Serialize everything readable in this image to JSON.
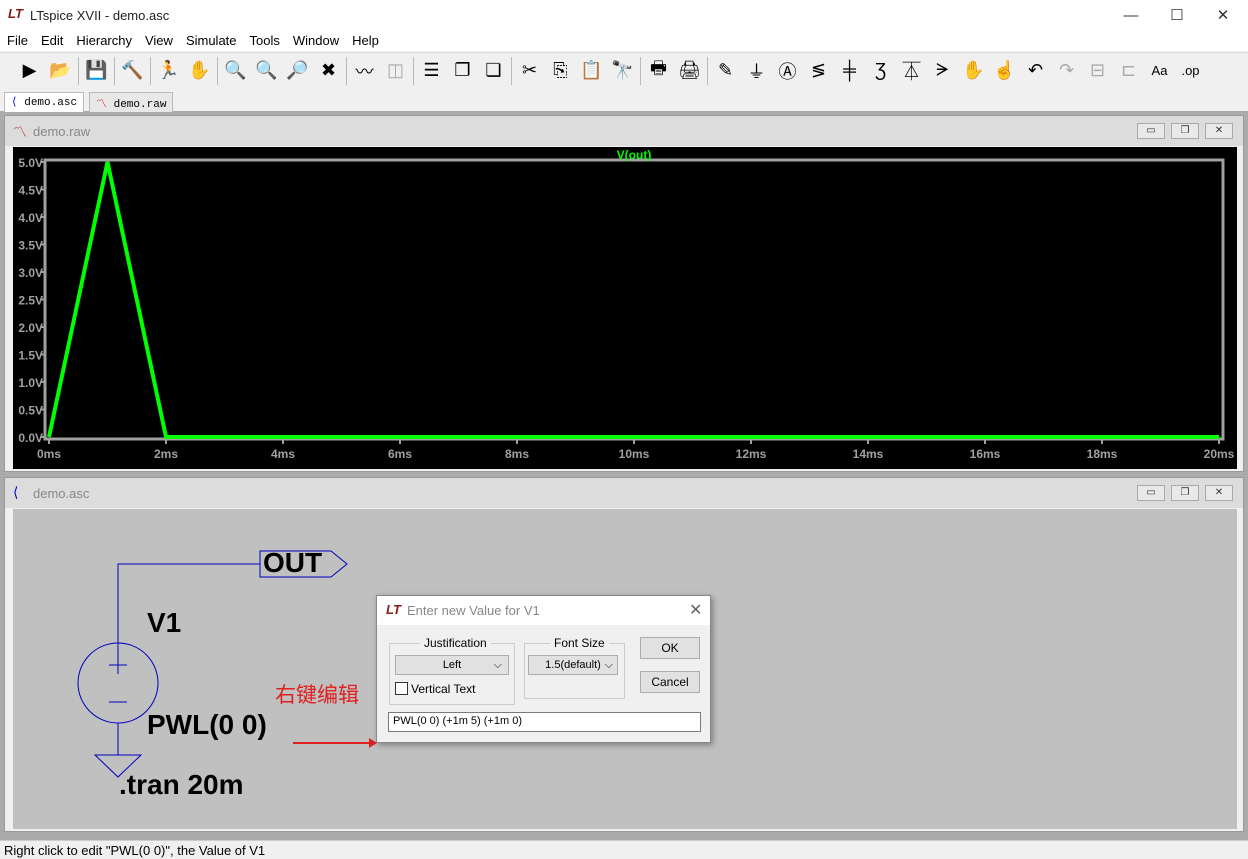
{
  "window": {
    "title": "LTspice XVII - demo.asc",
    "logo": "LT"
  },
  "menu": [
    "File",
    "Edit",
    "Hierarchy",
    "View",
    "Simulate",
    "Tools",
    "Window",
    "Help"
  ],
  "toolbar": [
    {
      "name": "run-icon",
      "glyph": "▶"
    },
    {
      "name": "open-icon",
      "glyph": "📂"
    },
    "sep",
    {
      "name": "save-icon",
      "glyph": "💾"
    },
    "sep",
    {
      "name": "control-panel-hammer-icon",
      "glyph": "🔨"
    },
    "sep",
    {
      "name": "halt-runner-icon",
      "glyph": "🏃"
    },
    {
      "name": "pan-hand-icon",
      "glyph": "✋",
      "dis": true
    },
    "sep",
    {
      "name": "zoom-in-icon",
      "glyph": "🔍"
    },
    {
      "name": "zoom-full-icon",
      "glyph": "🔍",
      "dis": true
    },
    {
      "name": "zoom-out-icon",
      "glyph": "🔎"
    },
    {
      "name": "zoom-cancel-icon",
      "glyph": "✖"
    },
    "sep",
    {
      "name": "autorange-waveform-icon",
      "glyph": "〰"
    },
    {
      "name": "fft-icon",
      "glyph": "◫",
      "dis": true
    },
    "sep",
    {
      "name": "tile-horizontal-icon",
      "glyph": "☰"
    },
    {
      "name": "cascade-icon",
      "glyph": "❐"
    },
    {
      "name": "close-all-icon",
      "glyph": "❏"
    },
    "sep",
    {
      "name": "cut-icon",
      "glyph": "✂"
    },
    {
      "name": "copy-icon",
      "glyph": "⎘"
    },
    {
      "name": "paste-icon",
      "glyph": "📋"
    },
    {
      "name": "find-icon",
      "glyph": "🔭"
    },
    "sep",
    {
      "name": "print-preview-icon",
      "glyph": "🖶"
    },
    {
      "name": "print-icon",
      "glyph": "🖨"
    },
    "sep",
    {
      "name": "draw-wire-icon",
      "glyph": "✎"
    },
    {
      "name": "ground-icon",
      "glyph": "⏚"
    },
    {
      "name": "label-net-icon",
      "glyph": "Ⓐ"
    },
    {
      "name": "resistor-icon",
      "glyph": "≶"
    },
    {
      "name": "capacitor-icon",
      "glyph": "╪"
    },
    {
      "name": "inductor-icon",
      "glyph": "Ʒ"
    },
    {
      "name": "diode-icon",
      "glyph": "⏄"
    },
    {
      "name": "component-icon",
      "glyph": "ᗒ"
    },
    {
      "name": "move-hand-icon",
      "glyph": "✋"
    },
    {
      "name": "drag-hand-icon",
      "glyph": "☝"
    },
    {
      "name": "undo-icon",
      "glyph": "↶"
    },
    {
      "name": "redo-icon",
      "glyph": "↷",
      "dis": true
    },
    {
      "name": "rotate-icon",
      "glyph": "⊟",
      "dis": true
    },
    {
      "name": "mirror-icon",
      "glyph": "⊏",
      "dis": true
    },
    {
      "name": "text-icon",
      "glyph": "Aa"
    },
    {
      "name": "spice-directive-icon",
      "glyph": ".op"
    }
  ],
  "tabs": [
    {
      "label": "demo.asc",
      "active": true
    },
    {
      "label": "demo.raw",
      "active": false
    }
  ],
  "waveform_window": {
    "title": "demo.raw"
  },
  "schematic_window": {
    "title": "demo.asc"
  },
  "chart_data": {
    "type": "line",
    "title": "",
    "series": [
      {
        "name": "V(out)",
        "color": "#00ff00",
        "x": [
          0,
          1,
          2,
          20
        ],
        "y": [
          0,
          5,
          0,
          0
        ]
      }
    ],
    "xlim": [
      0,
      20
    ],
    "ylim": [
      0,
      5
    ],
    "xticks": [
      "0ms",
      "2ms",
      "4ms",
      "6ms",
      "8ms",
      "10ms",
      "12ms",
      "14ms",
      "16ms",
      "18ms",
      "20ms"
    ],
    "yticks": [
      "0.0V",
      "0.5V",
      "1.0V",
      "1.5V",
      "2.0V",
      "2.5V",
      "3.0V",
      "3.5V",
      "4.0V",
      "4.5V",
      "5.0V"
    ],
    "background": "#000000",
    "grid": false
  },
  "schematic": {
    "net_label": "OUT",
    "source_name": "V1",
    "source_value": "PWL(0 0)",
    "directive": ".tran 20m",
    "annotation": "右键编辑",
    "annotation_color": "#e02020"
  },
  "dialog": {
    "title": "Enter new Value for V1",
    "justification_label": "Justification",
    "justification_value": "Left",
    "vertical_text_label": "Vertical Text",
    "vertical_text_checked": false,
    "font_size_label": "Font Size",
    "font_size_value": "1.5(default)",
    "ok": "OK",
    "cancel": "Cancel",
    "value": "PWL(0 0) (+1m 5) (+1m 0)"
  },
  "statusbar": {
    "text": "Right click to edit \"PWL(0 0)\", the Value of V1"
  }
}
